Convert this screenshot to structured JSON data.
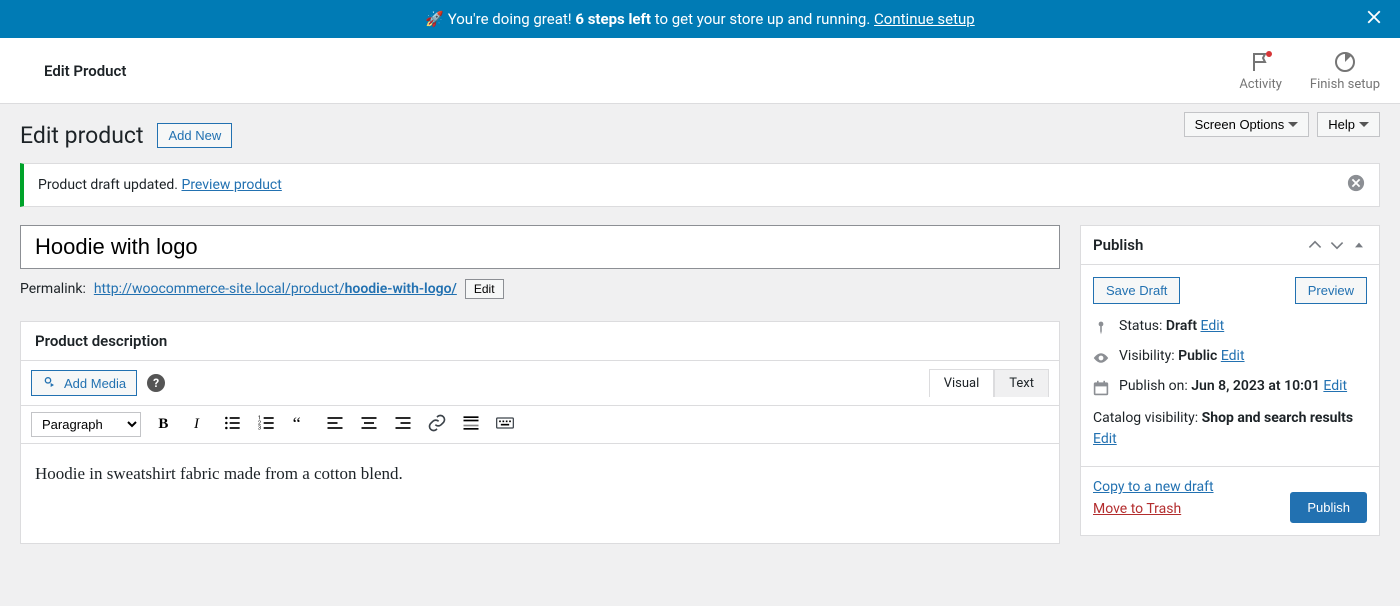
{
  "banner": {
    "emoji": "🚀",
    "text1": "You're doing great! ",
    "bold": "6 steps left",
    "text2": " to get your store up and running. ",
    "link": "Continue setup"
  },
  "header": {
    "title": "Edit Product",
    "activity": "Activity",
    "finish_setup": "Finish setup"
  },
  "top_buttons": {
    "screen_options": "Screen Options",
    "help": "Help"
  },
  "page": {
    "heading": "Edit product",
    "add_new": "Add New"
  },
  "notice": {
    "text": "Product draft updated. ",
    "link": "Preview product"
  },
  "product": {
    "title": "Hoodie with logo",
    "permalink_label": "Permalink: ",
    "permalink_base": "http://woocommerce-site.local/product/",
    "permalink_slug": "hoodie-with-logo/",
    "permalink_edit": "Edit",
    "description_heading": "Product description",
    "add_media": "Add Media",
    "tab_visual": "Visual",
    "tab_text": "Text",
    "format_select": "Paragraph",
    "body": "Hoodie in sweatshirt fabric made from a cotton blend."
  },
  "publish": {
    "title": "Publish",
    "save_draft": "Save Draft",
    "preview": "Preview",
    "status_label": "Status: ",
    "status_value": "Draft",
    "visibility_label": "Visibility: ",
    "visibility_value": "Public",
    "publish_on_label": "Publish on: ",
    "publish_on_value": "Jun 8, 2023 at 10:01",
    "catalog_label": "Catalog visibility: ",
    "catalog_value": "Shop and search results",
    "edit": "Edit",
    "copy_draft": "Copy to a new draft",
    "move_trash": "Move to Trash",
    "publish_btn": "Publish"
  }
}
